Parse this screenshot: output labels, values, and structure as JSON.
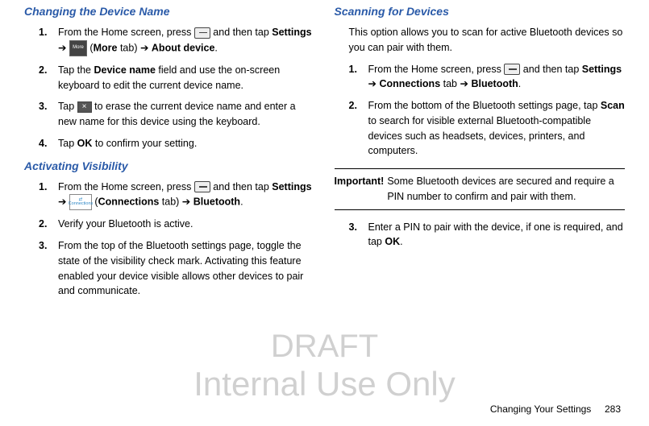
{
  "left": {
    "section1_title": "Changing the Device Name",
    "s1_step1_a": "From the Home screen, press ",
    "s1_step1_b": " and then tap ",
    "s1_step1_settings": "Settings",
    "s1_step1_arrow": " ➔ ",
    "s1_step1_paren": " (",
    "s1_step1_more": "More",
    "s1_step1_tab": " tab) ➔ ",
    "s1_step1_about": "About device",
    "s1_step1_dot": ".",
    "s1_step2_a": "Tap the ",
    "s1_step2_dn": "Device name",
    "s1_step2_b": " field and use the on-screen keyboard to edit the current device name.",
    "s1_step3_a": "Tap ",
    "s1_step3_b": " to erase the current device name and enter a new name for this device using the keyboard.",
    "s1_step4_a": "Tap ",
    "s1_step4_ok": "OK",
    "s1_step4_b": " to confirm your setting.",
    "section2_title": "Activating Visibility",
    "s2_step1_a": "From the Home screen, press ",
    "s2_step1_b": " and then tap ",
    "s2_step1_settings": "Settings",
    "s2_step1_arrow": " ➔ ",
    "s2_step1_paren": " (",
    "s2_step1_conn": "Connections",
    "s2_step1_tab": " tab) ➔ ",
    "s2_step1_bt": "Bluetooth",
    "s2_step1_dot": ".",
    "s2_step2": "Verify your Bluetooth is active.",
    "s2_step3": "From the top of the Bluetooth settings page, toggle the state of the visibility check mark. Activating this feature enabled your device visible allows other devices to pair and communicate."
  },
  "right": {
    "section_title": "Scanning for Devices",
    "intro": "This option allows you to scan for active Bluetooth devices so you can pair with them.",
    "step1_a": "From the Home screen, press ",
    "step1_b": " and then tap ",
    "step1_settings": "Settings",
    "step1_arrow1": " ➔ ",
    "step1_conn": "Connections",
    "step1_tab": " tab ➔ ",
    "step1_bt": "Bluetooth",
    "step1_dot": ".",
    "step2_a": "From the bottom of the Bluetooth settings page, tap ",
    "step2_scan": "Scan",
    "step2_b": " to search for visible external Bluetooth-compatible devices such as headsets, devices, printers, and computers.",
    "imp_label": "Important!",
    "imp_text": " Some Bluetooth devices are secured and require a PIN number to confirm and pair with them.",
    "step3_a": "Enter a PIN to pair with the device, if one is required, and tap ",
    "step3_ok": "OK",
    "step3_dot": "."
  },
  "nums": {
    "n1": "1.",
    "n2": "2.",
    "n3": "3.",
    "n4": "4."
  },
  "icons": {
    "more_label": "More",
    "conn_top": "⇄",
    "conn_label": "Connections"
  },
  "watermark": {
    "draft": "DRAFT",
    "internal": "Internal Use Only"
  },
  "footer": {
    "section": "Changing Your Settings",
    "page": "283"
  }
}
